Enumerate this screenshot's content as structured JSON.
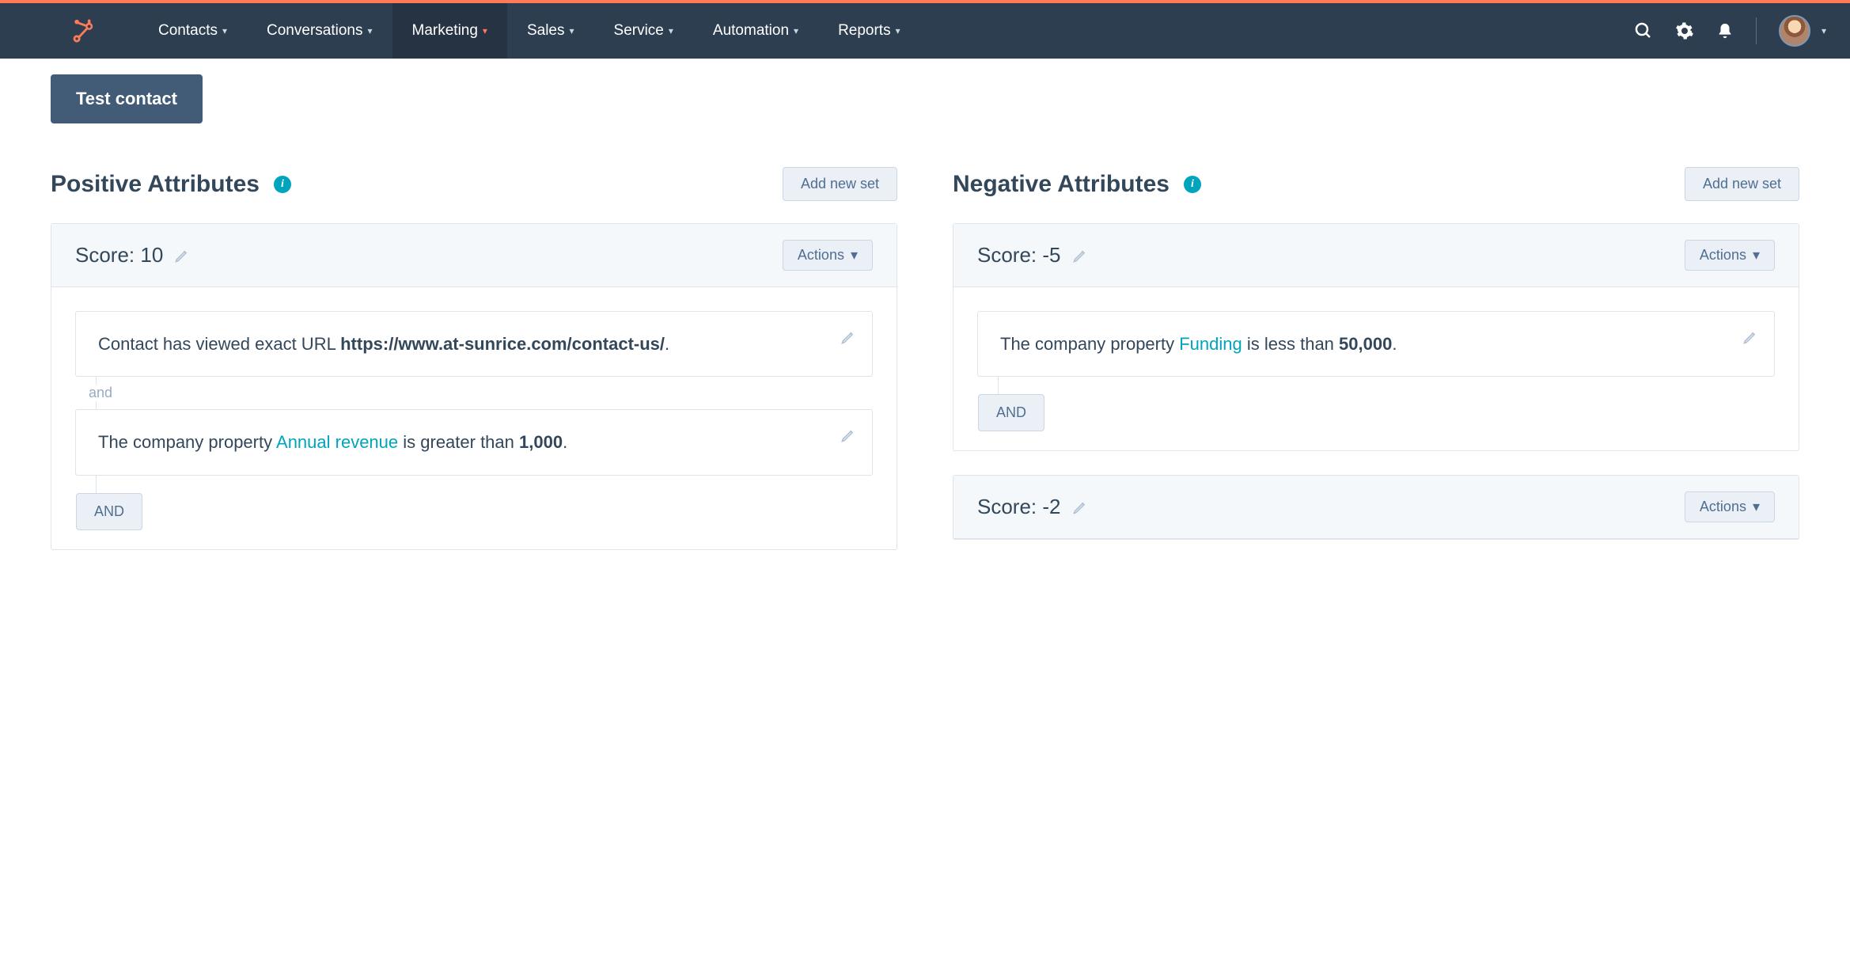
{
  "nav": {
    "items": [
      {
        "label": "Contacts",
        "active": false
      },
      {
        "label": "Conversations",
        "active": false
      },
      {
        "label": "Marketing",
        "active": true
      },
      {
        "label": "Sales",
        "active": false
      },
      {
        "label": "Service",
        "active": false
      },
      {
        "label": "Automation",
        "active": false
      },
      {
        "label": "Reports",
        "active": false
      }
    ]
  },
  "testButton": "Test contact",
  "positive": {
    "title": "Positive Attributes",
    "addNew": "Add new set",
    "cards": [
      {
        "score": "Score: 10",
        "actions": "Actions",
        "rules": [
          {
            "prefix": "Contact has viewed exact URL ",
            "bold": "https://www.at-sunrice.com/contact-us/",
            "suffix": "."
          },
          {
            "prefix": "The company property ",
            "link": "Annual revenue",
            "mid": " is greater than ",
            "bold": "1,000",
            "suffix": "."
          }
        ],
        "connector": "and",
        "andBtn": "AND"
      }
    ]
  },
  "negative": {
    "title": "Negative Attributes",
    "addNew": "Add new set",
    "cards": [
      {
        "score": "Score: -5",
        "actions": "Actions",
        "rules": [
          {
            "prefix": "The company property ",
            "link": "Funding",
            "mid": " is less than ",
            "bold": "50,000",
            "suffix": "."
          }
        ],
        "andBtn": "AND"
      },
      {
        "score": "Score: -2",
        "actions": "Actions"
      }
    ]
  }
}
